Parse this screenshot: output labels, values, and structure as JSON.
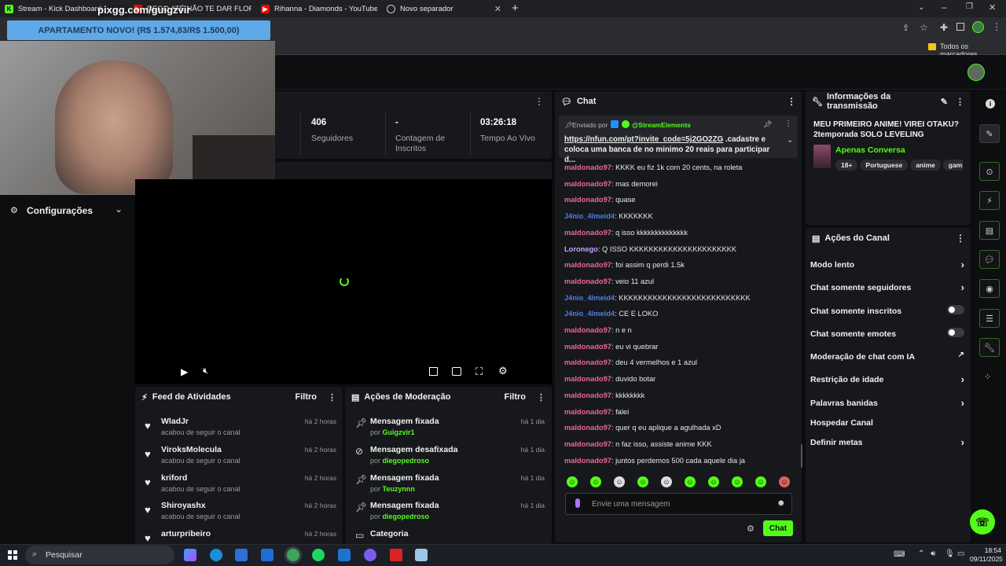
{
  "browser": {
    "tabs": [
      {
        "title": "Stream - Kick Dashboard"
      },
      {
        "title": "DEGO ATÉ NÃO TE DAR FLORE"
      },
      {
        "title": "Rihanna - Diamonds - YouTube"
      },
      {
        "title": "Novo separador"
      }
    ],
    "new_tab": "+",
    "bookmarks_label": "Todos os marcadores"
  },
  "overlay": {
    "url_text": "pixgg.com/guigzvir",
    "banner": "APARTAMENTO NOVO! (R$ 1.574,83/R$ 1.500,00)"
  },
  "sidebar": {
    "settings_label": "Configurações"
  },
  "stats": [
    {
      "value": "406",
      "label": "Seguidores"
    },
    {
      "value": "-",
      "label": "Contagem de Inscritos"
    },
    {
      "value": "03:26:18",
      "label": "Tempo Ao Vivo"
    }
  ],
  "activity_feed": {
    "title": "Feed de Atividades",
    "filter": "Filtro",
    "items": [
      {
        "name": "WladJr",
        "action": "acabou de seguir o canal",
        "time": "há 2 horas"
      },
      {
        "name": "ViroksMolecula",
        "action": "acabou de seguir o canal",
        "time": "há 2 horas"
      },
      {
        "name": "kriford",
        "action": "acabou de seguir o canal",
        "time": "há 2 horas"
      },
      {
        "name": "Shiroyashx",
        "action": "acabou de seguir o canal",
        "time": "há 2 horas"
      },
      {
        "name": "arturpribeiro",
        "action": "",
        "time": "há 2 horas"
      }
    ]
  },
  "moderation": {
    "title": "Ações de Moderação",
    "filter": "Filtro",
    "items": [
      {
        "action": "Mensagem fixada",
        "prefix": "por",
        "user": "Guigzvir1",
        "time": "há 1 dia"
      },
      {
        "action": "Mensagem desafixada",
        "prefix": "por",
        "user": "diegopedroso",
        "time": "há 1 dia"
      },
      {
        "action": "Mensagem fixada",
        "prefix": "por",
        "user": "Teuzynnn",
        "time": "há 1 dia"
      },
      {
        "action": "Mensagem fixada",
        "prefix": "por",
        "user": "diegopedroso",
        "time": "há 1 dia"
      },
      {
        "action": "Categoria",
        "prefix": "",
        "user": "",
        "time": ""
      }
    ]
  },
  "chat": {
    "title": "Chat",
    "pinned": {
      "sent_by": "Enviado por",
      "author": "@StreamElements",
      "link": "https://nfun.com/pt?invite_code=5j2GO2ZG",
      "text_1": " .cadastre e",
      "text_2": "coloca uma banca de no minimo 20 reais para participar d..."
    },
    "messages": [
      {
        "user": "maldonado97",
        "color": "#e8679a",
        "text": ": KKKK eu fiz 1k com 20 cents, na roleta"
      },
      {
        "user": "maldonado97",
        "color": "#e8679a",
        "text": ": mas demorei"
      },
      {
        "user": "maldonado97",
        "color": "#e8679a",
        "text": ": quase"
      },
      {
        "user": "J4nio_4lmeid4",
        "color": "#4d7fe0",
        "text": ": KKKKKKK"
      },
      {
        "user": "maldonado97",
        "color": "#e8679a",
        "text": ": q isso kkkkkkkkkkkkkk"
      },
      {
        "user": "Loronego",
        "color": "#c9a0ff",
        "text": ": Q ISSO KKKKKKKKKKKKKKKKKKKKKK"
      },
      {
        "user": "maldonado97",
        "color": "#e8679a",
        "text": ": foi assim q perdi 1.5k"
      },
      {
        "user": "maldonado97",
        "color": "#e8679a",
        "text": ": veio 11 azul"
      },
      {
        "user": "J4nio_4lmeid4",
        "color": "#4d7fe0",
        "text": ": KKKKKKKKKKKKKKKKKKKKKKKKKKK"
      },
      {
        "user": "J4nio_4lmeid4",
        "color": "#4d7fe0",
        "text": ": CE E LOKO"
      },
      {
        "user": "maldonado97",
        "color": "#e8679a",
        "text": ": n e n"
      },
      {
        "user": "maldonado97",
        "color": "#e8679a",
        "text": ": eu vi quebrar"
      },
      {
        "user": "maldonado97",
        "color": "#e8679a",
        "text": ": deu 4 vermelhos e 1 azul"
      },
      {
        "user": "maldonado97",
        "color": "#e8679a",
        "text": ": duvido botar"
      },
      {
        "user": "maldonado97",
        "color": "#e8679a",
        "text": ": kkkkkkkk"
      },
      {
        "user": "maldonado97",
        "color": "#e8679a",
        "text": ": falei"
      },
      {
        "user": "maldonado97",
        "color": "#e8679a",
        "text": ": quer q eu aplique a agulhada xD"
      },
      {
        "user": "maldonado97",
        "color": "#e8679a",
        "text": ": n faz isso, assiste anime KKK"
      },
      {
        "user": "maldonado97",
        "color": "#e8679a",
        "text": ": juntos perdemos 500 cada aquele dia ja"
      }
    ],
    "input_placeholder": "Envie uma mensagem",
    "send_label": "Chat"
  },
  "stream_info": {
    "title": "Informações da transmissão",
    "stream_title": "MEU PRIMEIRO ANIME! VIREI OTAKU? 2temporada SOLO LEVELING",
    "category": "Apenas Conversa",
    "tags": [
      "18+",
      "Portuguese",
      "anime",
      "gaming"
    ]
  },
  "channel_actions": {
    "title": "Ações do Canal",
    "items": [
      {
        "label": "Modo lento",
        "control": "chevron"
      },
      {
        "label": "Chat somente seguidores",
        "control": "chevron"
      },
      {
        "label": "Chat somente inscritos",
        "control": "toggle"
      },
      {
        "label": "Chat somente emotes",
        "control": "toggle"
      },
      {
        "label": "Moderação de chat com IA",
        "control": "external"
      },
      {
        "label": "Restrição de idade",
        "control": "chevron"
      },
      {
        "label": "Palavras banidas",
        "control": "chevron"
      },
      {
        "label": "Hospedar Canal",
        "control": "none"
      },
      {
        "label": "Definir metas",
        "control": "chevron"
      }
    ]
  },
  "taskbar": {
    "search": "Pesquisar",
    "time": "18:54",
    "date": "09/11/2025"
  },
  "colors": {
    "accent": "#53fc18",
    "panel": "#17181c",
    "background": "#0b0c0e"
  }
}
